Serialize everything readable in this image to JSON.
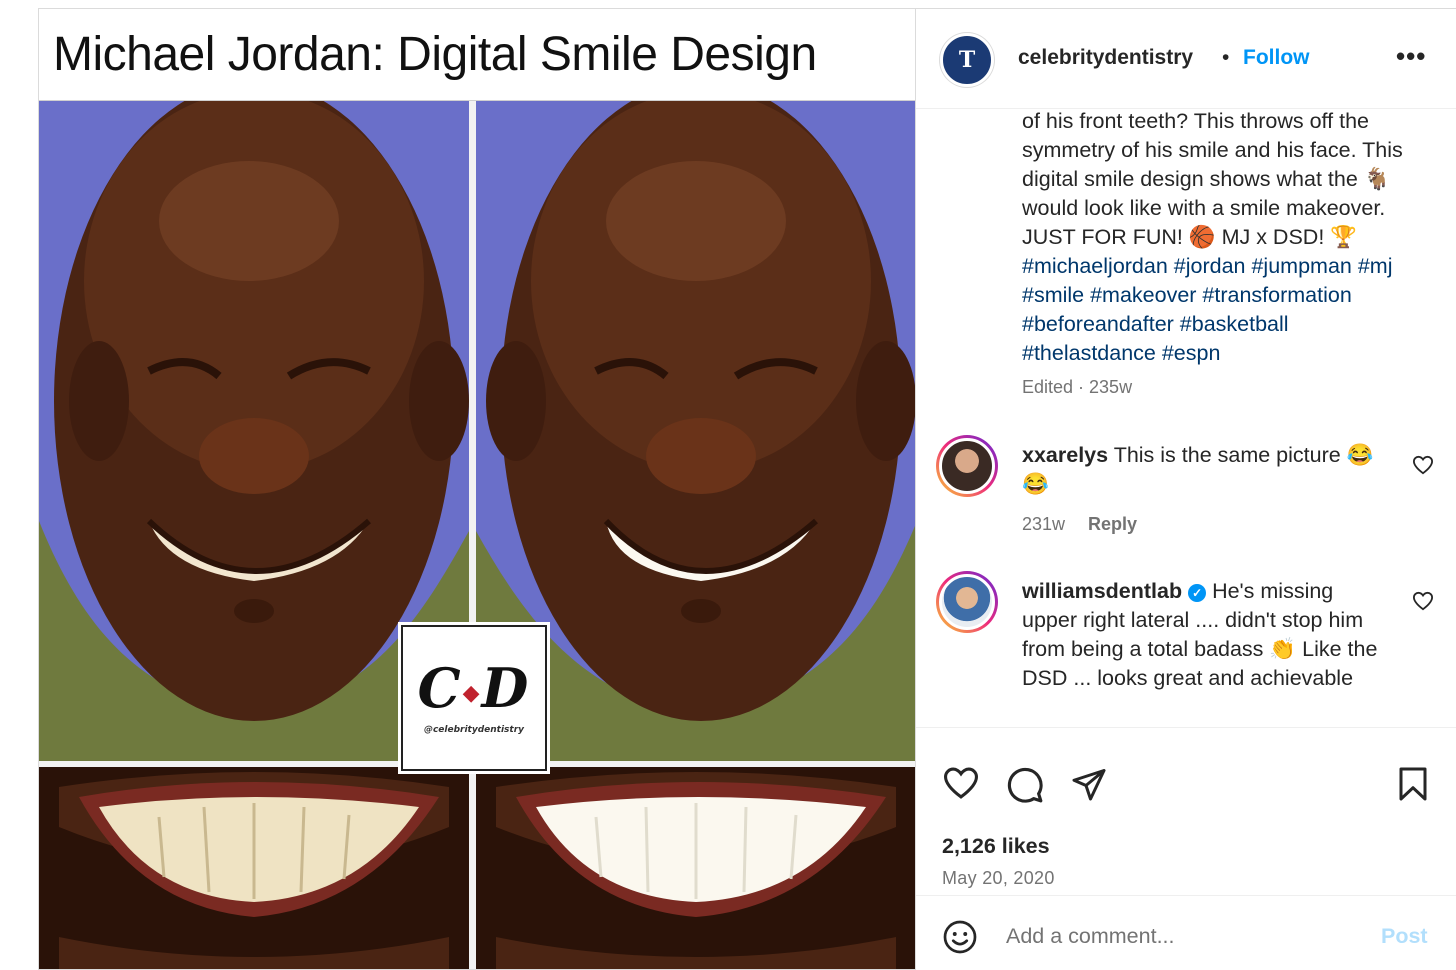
{
  "post_image": {
    "title": "Michael Jordan: Digital Smile Design",
    "logo_text_left": "C",
    "logo_text_right": "D",
    "logo_handle": "@celebritydentistry"
  },
  "header": {
    "username": "celebritydentistry",
    "separator": "•",
    "follow_label": "Follow",
    "more_label": "•••"
  },
  "caption": {
    "line1": "of his front teeth? This throws off the symmetry of his smile and his face. This digital smile design shows what the 🐐 would look like with a smile makeover. JUST FOR FUN! 🏀 MJ x DSD! 🏆",
    "hashtags": "#michaeljordan #jordan #jumpman #mj #smile #makeover #transformation #beforeandafter #basketball #thelastdance #espn",
    "meta": "Edited · 235w"
  },
  "comments": [
    {
      "username": "xxarelys",
      "text": "This is the same picture 😂😂",
      "age": "231w",
      "reply_label": "Reply",
      "verified": false
    },
    {
      "username": "williamsdentlab",
      "text": "He's missing upper right lateral .... didn't stop him from being a total badass 👏 Like the DSD ... looks great and achievable",
      "verified": true
    }
  ],
  "actions": {
    "likes": "2,126 likes",
    "date": "May 20, 2020"
  },
  "add_comment": {
    "placeholder": "Add a comment...",
    "post_label": "Post"
  },
  "icons": {
    "like": "heart-icon",
    "comment": "comment-icon",
    "share": "share-icon",
    "save": "bookmark-icon",
    "emoji": "emoji-icon",
    "more": "more-icon",
    "verified": "verified-badge-icon"
  },
  "colors": {
    "link_blue": "#0095f6",
    "hashtag_blue": "#00376b",
    "muted_text": "#737373",
    "post_button_disabled": "#b2dffc",
    "backdrop_blue": "#6a6fc9"
  }
}
